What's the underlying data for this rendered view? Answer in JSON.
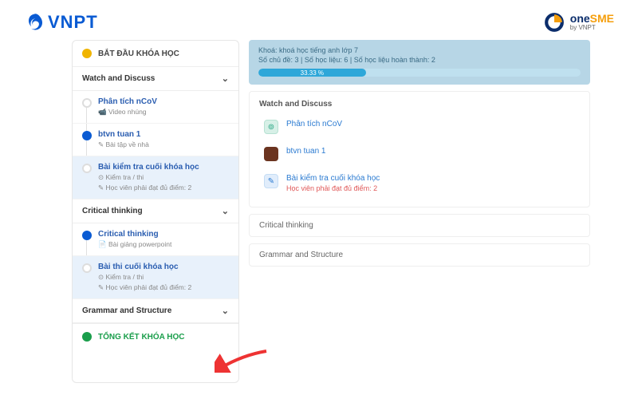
{
  "header": {
    "brand": "VNPT",
    "onesme_one": "one",
    "onesme_sme": "SME",
    "onesme_sub": "by VNPT"
  },
  "sidebar": {
    "start_title": "BẮT ĐẦU KHÓA HỌC",
    "sections": {
      "watch": "Watch and Discuss",
      "critical": "Critical thinking",
      "grammar": "Grammar and Structure"
    },
    "watch_items": [
      {
        "title": "Phân tích nCoV",
        "sub": "📹 Video nhúng",
        "dot": "grey"
      },
      {
        "title": "btvn tuan 1",
        "sub": "✎ Bài tập về nhà",
        "dot": "blue"
      },
      {
        "title": "Bài kiểm tra cuối khóa học",
        "sub": "⊙ Kiểm tra / thi",
        "sub2": "✎ Học viên phải đạt đủ điểm: 2",
        "dot": "grey"
      }
    ],
    "critical_items": [
      {
        "title": "Critical thinking",
        "sub": "📄 Bài giảng powerpoint",
        "dot": "blue"
      },
      {
        "title": "Bài thi cuối khóa học",
        "sub": "⊙ Kiểm tra / thi",
        "sub2": "✎ Học viên phải đạt đủ điểm: 2",
        "dot": "grey"
      }
    ],
    "end_title": "TỔNG KẾT KHÓA HỌC"
  },
  "course": {
    "title": "Khoá: khoá học tiếng anh lớp 7",
    "stats": "Số chủ đề: 3 | Số học liệu: 6 | Số học liệu hoàn thành: 2",
    "progress_label": "33.33 %"
  },
  "main": {
    "section_title": "Watch and Discuss",
    "rows": [
      {
        "title": "Phân tích nCoV",
        "sub": "",
        "ico": "teal",
        "glyph": "⊚"
      },
      {
        "title": "btvn tuan 1",
        "sub": "",
        "ico": "brown",
        "glyph": ""
      },
      {
        "title": "Bài kiểm tra cuối khóa học",
        "sub": "Học viên phải đạt đủ điểm: 2",
        "ico": "blue",
        "glyph": "✎"
      }
    ],
    "thin1": "Critical thinking",
    "thin2": "Grammar and Structure"
  },
  "colors": {
    "accent": "#0a5bd3",
    "green": "#1a9e4b",
    "yellow": "#f0b400"
  }
}
